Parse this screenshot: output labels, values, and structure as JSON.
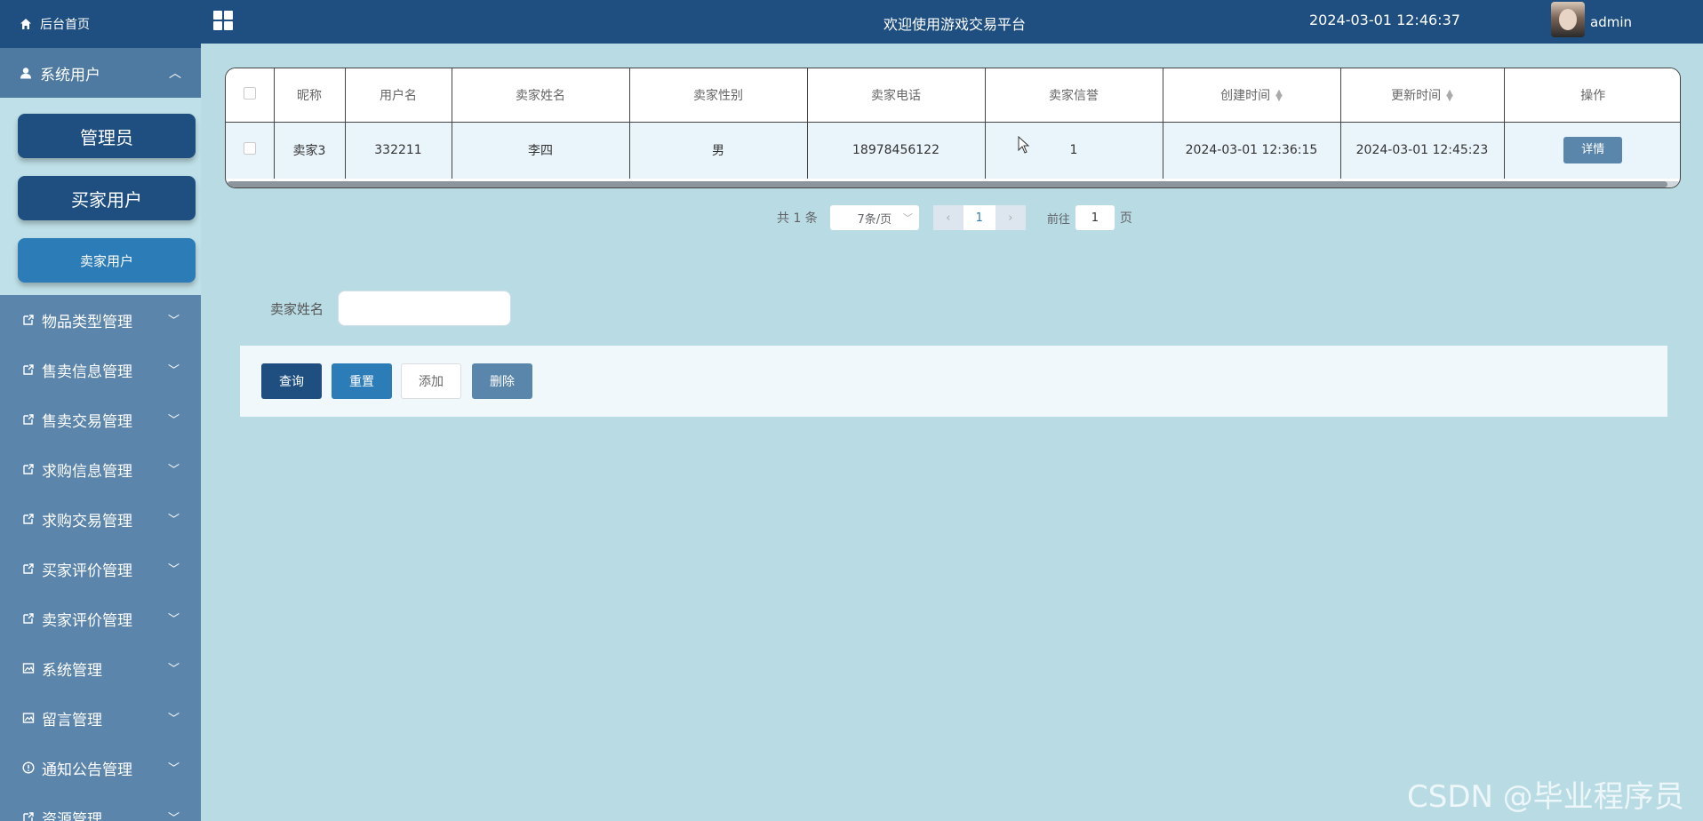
{
  "sidebar": {
    "home": "后台首页",
    "section": "系统用户",
    "sub_items": [
      "管理员",
      "买家用户",
      "卖家用户"
    ],
    "menu": [
      "物品类型管理",
      "售卖信息管理",
      "售卖交易管理",
      "求购信息管理",
      "求购交易管理",
      "买家评价管理",
      "卖家评价管理",
      "系统管理",
      "留言管理",
      "通知公告管理",
      "资源管理"
    ],
    "menu_icons": [
      "external-link-icon",
      "external-link-icon",
      "external-link-icon",
      "external-link-icon",
      "external-link-icon",
      "external-link-icon",
      "external-link-icon",
      "image-icon",
      "image-icon",
      "info-circle-icon",
      "external-link-icon"
    ]
  },
  "header": {
    "title": "欢迎使用游戏交易平台",
    "datetime": "2024-03-01 12:46:37",
    "username": "admin"
  },
  "table": {
    "columns": [
      "昵称",
      "用户名",
      "卖家姓名",
      "卖家性别",
      "卖家电话",
      "卖家信誉",
      "创建时间",
      "更新时间",
      "操作"
    ],
    "rows": [
      {
        "nickname": "卖家3",
        "username": "332211",
        "name": "李四",
        "gender": "男",
        "phone": "18978456122",
        "credit": "1",
        "created": "2024-03-01 12:36:15",
        "updated": "2024-03-01 12:45:23",
        "action": "详情"
      }
    ]
  },
  "pagination": {
    "total": "共 1 条",
    "page_size": "7条/页",
    "current_page": "1",
    "goto_label": "前往",
    "goto_value": "1",
    "page_suffix": "页"
  },
  "search": {
    "label": "卖家姓名",
    "value": ""
  },
  "actions": {
    "query": "查询",
    "reset": "重置",
    "add": "添加",
    "delete": "删除"
  },
  "watermark": "CSDN @毕业程序员",
  "colors": {
    "primary_dark": "#1e4f80",
    "primary": "#2c7cb8",
    "sidebar_bg": "#5b85ab",
    "content_bg": "#b9dbe4"
  }
}
